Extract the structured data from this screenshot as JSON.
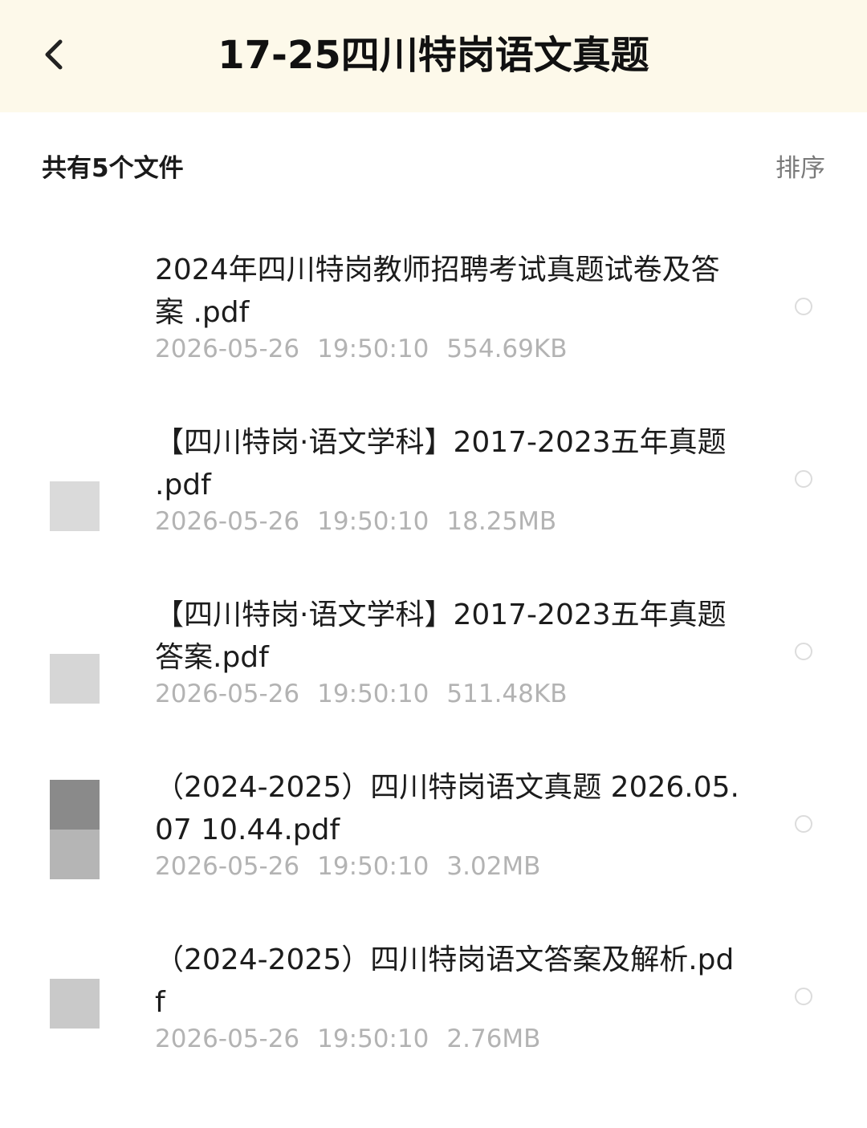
{
  "header": {
    "title": "17-25四川特岗语文真题",
    "back_icon": "chevron-left-icon"
  },
  "summary": {
    "count_label": "共有5个文件",
    "sort_label": "排序"
  },
  "files": [
    {
      "name": "2024年四川特岗教师招聘考试真题试卷及答案 .pdf",
      "date": "2026-05-26",
      "time": "19:50:10",
      "size": "554.69KB"
    },
    {
      "name": "【四川特岗·语文学科】2017-2023五年真题 .pdf",
      "date": "2026-05-26",
      "time": "19:50:10",
      "size": "18.25MB"
    },
    {
      "name": "【四川特岗·语文学科】2017-2023五年真题答案.pdf",
      "date": "2026-05-26",
      "time": "19:50:10",
      "size": "511.48KB"
    },
    {
      "name": "（2024-2025）四川特岗语文真题 2026.05.07 10.44.pdf",
      "date": "2026-05-26",
      "time": "19:50:10",
      "size": "3.02MB"
    },
    {
      "name": "（2024-2025）四川特岗语文答案及解析.pdf",
      "date": "2026-05-26",
      "time": "19:50:10",
      "size": "2.76MB"
    }
  ],
  "colors": {
    "header_bg": "#fdf9ea",
    "meta_text": "#b3b3b3",
    "thumb_light": "#d6d6d6",
    "thumb_dark": "#8a8a8a"
  }
}
